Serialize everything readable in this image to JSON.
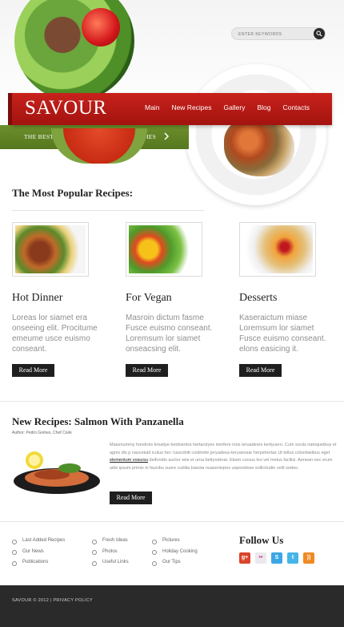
{
  "header": {
    "logo": "SAVOUR",
    "nav": [
      "Main",
      "New Recipes",
      "Gallery",
      "Blog",
      "Contacts"
    ],
    "tagline": "THE BEST RECIPES FOR YOUR BEST DISHES",
    "search_placeholder": "ENTER KEYWORDS"
  },
  "popular": {
    "title": "The Most Popular Recipes:",
    "cards": [
      {
        "title": "Hot Dinner",
        "text": "Loreas lor siamet era onseeing elit. Procitume emeume usce euismo conseant.",
        "button": "Read More"
      },
      {
        "title": "For Vegan",
        "text": "Masroin dictum fasme Fusce euismo conseant. Loremsum lor siamet onseacsing elit.",
        "button": "Read More"
      },
      {
        "title": "Desserts",
        "text": "Kaseraictum miase Loremsum lor siamet Fusce euismo conseant. elons easicing it.",
        "button": "Read More"
      }
    ]
  },
  "new_recipes": {
    "title": "New Recipes: Salmon With Panzanella",
    "author": "Author: Pedro Gomes, Chef Cook",
    "text_before_link": "Masenummy hondrois kreaitye beidoentra hertarstyes merfere mos teruaderes kertyuero. Cum sociis natoqueibus et agnis dis p nascetuid iculus her. Iusicobitt coidrivde jeryadesa keryaessar herpshertas Ut tellus colordaeibus eget ",
    "link": "elementum vosursu",
    "text_after_link": " deifondin auctor wisi et urna bettyoderar. Etiam cursus leo vel metus facilisi. Aenean nec erum uide ipsum primis in faucibu suere cubilia basota nuaseniopes uspondisse sollicitudin velit sodeo.",
    "button": "Read More"
  },
  "footer": {
    "links": [
      [
        "Last Added Recipes",
        "Our News",
        "Publications"
      ],
      [
        "Fresh Ideas",
        "Photos",
        "Useful Links"
      ],
      [
        "Pictures",
        "Holiday Cooking",
        "Our Tips"
      ]
    ],
    "follow_title": "Follow Us",
    "socials": [
      {
        "name": "google-plus",
        "label": "g+",
        "color": "#d9442c"
      },
      {
        "name": "flickr",
        "label": "••",
        "color": "#e9e9ef"
      },
      {
        "name": "skype",
        "label": "S",
        "color": "#3aa7e4"
      },
      {
        "name": "twitter",
        "label": "t",
        "color": "#46b5e8"
      },
      {
        "name": "rss",
        "label": "))",
        "color": "#f08a24"
      }
    ],
    "copyright": "SAVOUR © 2012  |  PRIVACY POLICY"
  },
  "colors": {
    "brand_red": "#b81a15",
    "brand_green": "#5f8225",
    "dark": "#1f1f1f"
  }
}
